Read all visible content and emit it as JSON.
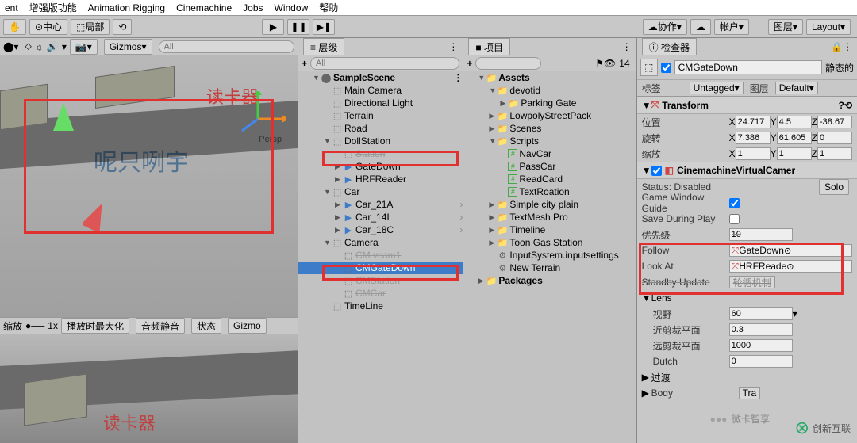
{
  "menu": [
    "ent",
    "增强版功能",
    "Animation Rigging",
    "Cinemachine",
    "Jobs",
    "Window",
    "帮助"
  ],
  "toolbar": {
    "center": "中心",
    "local": "局部",
    "collab": "协作",
    "account": "帐户",
    "layers": "图层",
    "layout": "Layout"
  },
  "scene_tools": {
    "gizmos": "Gizmos",
    "all": "All",
    "zoom_lbl": "缩放",
    "zoom_val": "1x",
    "maxplay": "播放时最大化",
    "mute": "音频静音",
    "status": "状态",
    "gizmo2": "Gizmo"
  },
  "hierarchy": {
    "tab": "层级",
    "plus": "+",
    "scene": "SampleScene",
    "items": [
      {
        "label": "Main Camera",
        "ind": 2,
        "icon": "cube"
      },
      {
        "label": "Directional Light",
        "ind": 2,
        "icon": "cube"
      },
      {
        "label": "Terrain",
        "ind": 2,
        "icon": "cube"
      },
      {
        "label": "Road",
        "ind": 2,
        "icon": "cube"
      },
      {
        "label": "DollStation",
        "ind": 2,
        "icon": "cube",
        "arrow": "▼"
      },
      {
        "label": "Station",
        "ind": 3,
        "icon": "cube",
        "strike": true
      },
      {
        "label": "GateDown",
        "ind": 3,
        "icon": "blue",
        "arrow": "▶"
      },
      {
        "label": "HRFReader",
        "ind": 3,
        "icon": "blue",
        "arrow": "▶"
      },
      {
        "label": "Car",
        "ind": 2,
        "icon": "cube",
        "arrow": "▼"
      },
      {
        "label": "Car_21A",
        "ind": 3,
        "icon": "blue",
        "arrow": "▶",
        "chev": true
      },
      {
        "label": "Car_14I",
        "ind": 3,
        "icon": "blue",
        "arrow": "▶",
        "chev": true
      },
      {
        "label": "Car_18C",
        "ind": 3,
        "icon": "blue",
        "arrow": "▶",
        "chev": true
      },
      {
        "label": "Camera",
        "ind": 2,
        "icon": "cube",
        "arrow": "▼"
      },
      {
        "label": "CM vcam1",
        "ind": 3,
        "icon": "cube",
        "strike": true
      },
      {
        "label": "CMGateDown",
        "ind": 3,
        "icon": "cube",
        "selected": true
      },
      {
        "label": "CMStation",
        "ind": 3,
        "icon": "cube",
        "strike": true
      },
      {
        "label": "CMCar",
        "ind": 3,
        "icon": "cube",
        "strike": true
      },
      {
        "label": "TimeLine",
        "ind": 2,
        "icon": "cube"
      }
    ]
  },
  "project": {
    "tab": "项目",
    "vis": "14",
    "assets": "Assets",
    "items": [
      {
        "label": "devotid",
        "ind": 2,
        "arrow": "▼",
        "icon": "folder"
      },
      {
        "label": "Parking Gate",
        "ind": 3,
        "arrow": "▶",
        "icon": "folder"
      },
      {
        "label": "LowpolyStreetPack",
        "ind": 2,
        "arrow": "▶",
        "icon": "folder"
      },
      {
        "label": "Scenes",
        "ind": 2,
        "arrow": "▶",
        "icon": "folder"
      },
      {
        "label": "Scripts",
        "ind": 2,
        "arrow": "▼",
        "icon": "folder"
      },
      {
        "label": "NavCar",
        "ind": 3,
        "icon": "cs"
      },
      {
        "label": "PassCar",
        "ind": 3,
        "icon": "cs"
      },
      {
        "label": "ReadCard",
        "ind": 3,
        "icon": "cs"
      },
      {
        "label": "TextRoation",
        "ind": 3,
        "icon": "cs"
      },
      {
        "label": "Simple city plain",
        "ind": 2,
        "arrow": "▶",
        "icon": "folder"
      },
      {
        "label": "TextMesh Pro",
        "ind": 2,
        "arrow": "▶",
        "icon": "folder"
      },
      {
        "label": "Timeline",
        "ind": 2,
        "arrow": "▶",
        "icon": "folder"
      },
      {
        "label": "Toon Gas Station",
        "ind": 2,
        "arrow": "▶",
        "icon": "folder"
      },
      {
        "label": "InputSystem.inputsettings",
        "ind": 2,
        "icon": "asset"
      },
      {
        "label": "New Terrain",
        "ind": 2,
        "icon": "asset"
      }
    ],
    "packages": "Packages"
  },
  "inspector": {
    "tab": "检查器",
    "name": "CMGateDown",
    "static": "静态的",
    "tag_lbl": "标签",
    "tag_val": "Untagged",
    "layer_lbl": "图层",
    "layer_val": "Default",
    "transform": {
      "title": "Transform",
      "pos_lbl": "位置",
      "px": "24.717",
      "py": "4.5",
      "pz": "-38.67",
      "rot_lbl": "旋转",
      "rx": "7.386",
      "ry": "61.605",
      "rz": "0",
      "scale_lbl": "缩放",
      "sx": "1",
      "sy": "1",
      "sz": "1"
    },
    "vcam": {
      "title": "CinemachineVirtualCamer",
      "status_lbl": "Status:",
      "status_val": "Disabled",
      "solo": "Solo",
      "guides_lbl": "Game Window Guide",
      "save_lbl": "Save During Play",
      "priority_lbl": "优先级",
      "priority_val": "10",
      "follow_lbl": "Follow",
      "follow_val": "GateDown",
      "lookat_lbl": "Look At",
      "lookat_val": "HRFReade",
      "standby_lbl": "Standby Update",
      "standby_val": "轮循机制",
      "lens_lbl": "Lens",
      "fov_lbl": "视野",
      "fov_val": "60",
      "near_lbl": "近剪裁平面",
      "near_val": "0.3",
      "far_lbl": "远剪裁平面",
      "far_val": "1000",
      "dutch_lbl": "Dutch",
      "dutch_val": "0",
      "trans_lbl": "过渡",
      "body_lbl": "Body",
      "body_val": "Tra"
    }
  },
  "overlay": {
    "cardreader": "读卡器",
    "watermark": "呢只咧宇",
    "wechat": "微卡智享",
    "logo": "创新互联"
  }
}
